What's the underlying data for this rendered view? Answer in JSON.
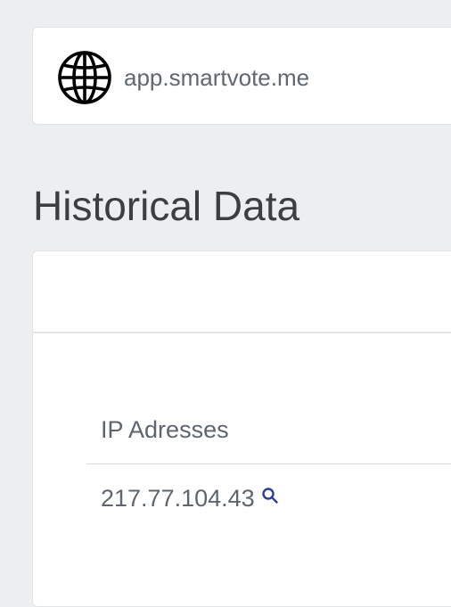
{
  "domain": {
    "icon": "globe-icon",
    "url": "app.smartvote.me"
  },
  "page": {
    "title": "Historical Data"
  },
  "table": {
    "column_header": "IP Adresses",
    "rows": [
      {
        "ip": "217.77.104.43",
        "action_icon": "search-icon"
      }
    ]
  },
  "colors": {
    "background": "#eceef0",
    "card": "#ffffff",
    "text": "#5e656c",
    "title": "#3b3f44",
    "link_icon": "#2e3f94"
  }
}
